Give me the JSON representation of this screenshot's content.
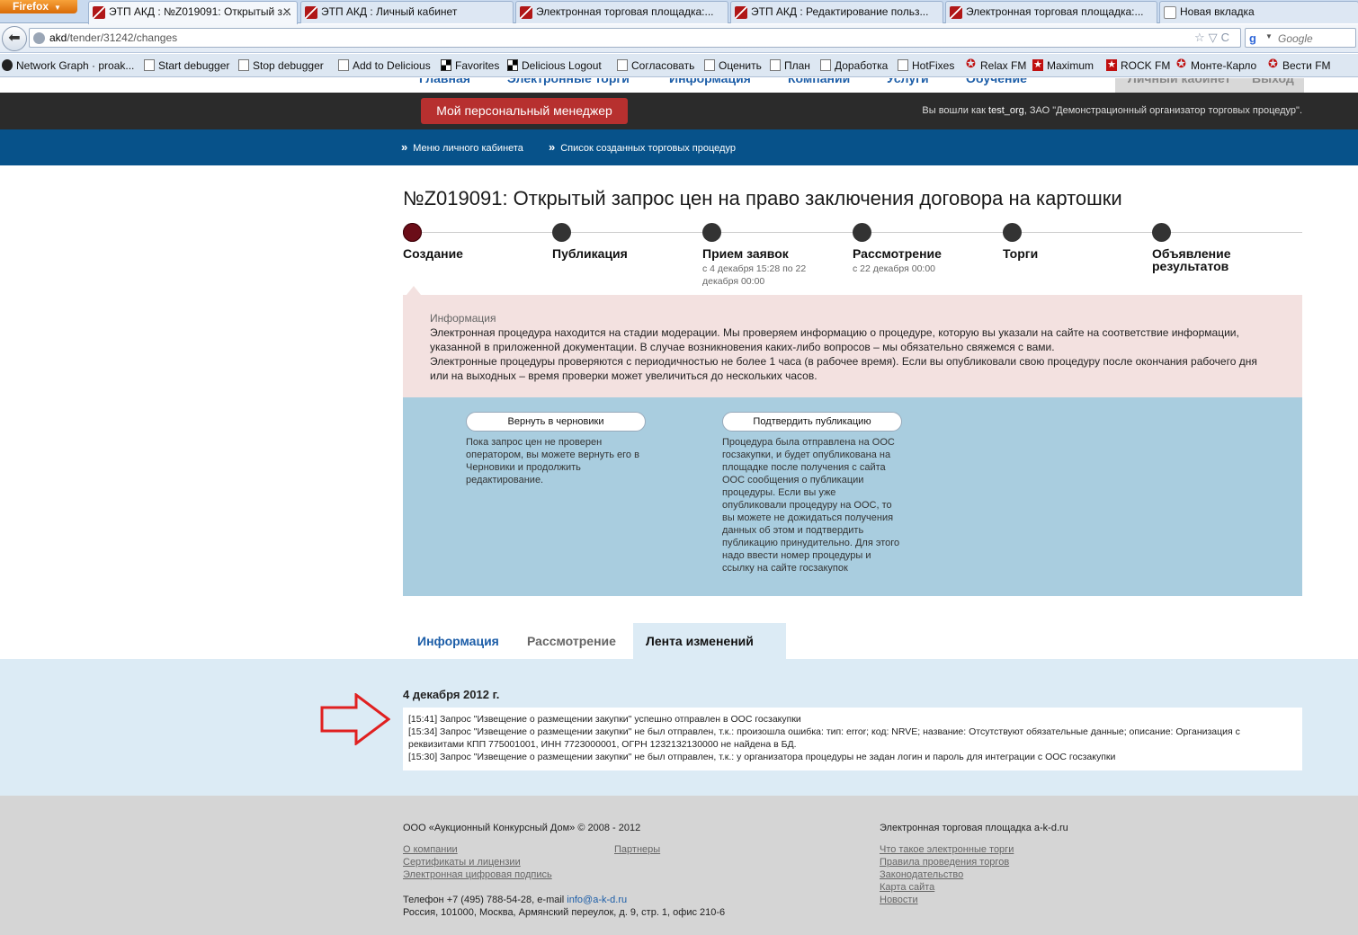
{
  "browser": {
    "app_button": "Firefox",
    "tabs": [
      {
        "label": "ЭТП АКД : №Z019091: Открытый з...",
        "active": true
      },
      {
        "label": "ЭТП АКД : Личный кабинет",
        "active": false
      },
      {
        "label": "Электронная торговая площадка:...",
        "active": false
      },
      {
        "label": "ЭТП АКД : Редактирование польз...",
        "active": false
      },
      {
        "label": "Электронная торговая площадка:...",
        "active": false
      },
      {
        "label": "Новая вкладка",
        "active": false
      }
    ],
    "url_host": "akd",
    "url_path": "/tender/31242/changes",
    "search_placeholder": "Google",
    "bookmarks": [
      "Network Graph · proak...",
      "Start debugger",
      "Stop debugger",
      "Add to Delicious",
      "Favorites",
      "Delicious Logout",
      "Согласовать",
      "Оценить",
      "План",
      "Доработка",
      "HotFixes",
      "Relax FM",
      "Maximum",
      "ROCK FM",
      "Монте-Карло",
      "Вести FM"
    ]
  },
  "site": {
    "top_nav": [
      "Главная",
      "Электронные торги",
      "Информация",
      "Компании",
      "Услуги",
      "Обучение",
      "Личный кабинет",
      "Выход"
    ],
    "manager_button": "Мой персональный менеджер",
    "logged_prefix": "Вы вошли как",
    "logged_user": "test_org",
    "logged_org": ", ЗАО \"Демонстрационный организатор торговых процедур\".",
    "breadcrumbs": [
      "Меню личного кабинета",
      "Список созданных торговых процедур"
    ]
  },
  "main": {
    "title": "№Z019091: Открытый запрос цен на право заключения договора на картошки",
    "steps": [
      {
        "label": "Создание",
        "sub": "",
        "active": true
      },
      {
        "label": "Публикация",
        "sub": "",
        "active": false
      },
      {
        "label": "Прием заявок",
        "sub": "с 4 декабря 15:28 по 22 декабря 00:00",
        "active": false
      },
      {
        "label": "Рассмотрение",
        "sub": "с 22 декабря 00:00",
        "active": false
      },
      {
        "label": "Торги",
        "sub": "",
        "active": false
      },
      {
        "label": "Объявление результатов",
        "sub": "",
        "active": false
      }
    ],
    "info_heading": "Информация",
    "info_lines": [
      "Электронная процедура находится на стадии модерации. Мы проверяем информацию о процедуре, которую вы указали на сайте на соответствие информации,",
      "указанной в приложенной документации. В случае возникновения каких-либо вопросов – мы обязательно свяжемся с вами.",
      "Электронные процедуры проверяются с периодичностью не более 1 часа (в рабочее время). Если вы опубликовали свою процедуру после окончания рабочего дня",
      "или на выходных – время проверки может увеличиться до нескольких часов."
    ],
    "actions": [
      {
        "button": "Вернуть в черновики",
        "desc": "Пока запрос цен не проверен оператором, вы можете вернуть его в Черновики и продолжить редактирование."
      },
      {
        "button": "Подтвердить публикацию",
        "desc": "Процедура была отправлена на ООС госзакупки, и будет опубликована на площадке после получения с сайта ООС сообщения о публикации процедуры. Если вы уже опубликовали процедуру на ООС, то вы можете не дожидаться получения данных об этом и подтвердить публикацию принудительно. Для этого надо ввести номер процедуры и ссылку на сайте госзакупок"
      }
    ],
    "tabs": [
      "Информация",
      "Рассмотрение",
      "Лента изменений"
    ],
    "feed_date": "4 декабря 2012 г.",
    "feed": [
      "[15:41] Запрос \"Извещение о размещении закупки\" успешно отправлен в ООС госзакупки",
      "[15:34] Запрос \"Извещение о размещении закупки\" не был отправлен, т.к.: произошла ошибка: тип: error; код: NRVE; название: Отсутствуют обязательные данные; описание: Организация с реквизитами КПП 775001001, ИНН 7723000001, ОГРН 1232132130000 не найдена в БД.",
      "[15:30] Запрос \"Извещение о размещении закупки\" не был отправлен, т.к.: у организатора процедуры не задан логин и пароль для интеграции с ООС госзакупки"
    ]
  },
  "footer": {
    "copyright": "ООО «Аукционный Конкурсный Дом» © 2008 - 2012",
    "col1_links": [
      "О компании",
      "Сертификаты и лицензии",
      "Электронная цифровая подпись"
    ],
    "col2_links": [
      "Партнеры"
    ],
    "phone_prefix": "Телефон +7 (495) 788-54-28, e-mail",
    "email": "info@a-k-d.ru",
    "address": "Россия, 101000, Москва, Армянский переулок, д. 9, стр. 1, офис 210-6",
    "right_title": "Электронная торговая площадка a-k-d.ru",
    "right_links": [
      "Что такое электронные торги",
      "Правила проведения торгов",
      "Законодательство",
      "Карта сайта",
      "Новости"
    ]
  },
  "colors": {
    "accent_red": "#b7302f",
    "nav_blue": "#07528a",
    "active_step": "#6b0d18"
  }
}
